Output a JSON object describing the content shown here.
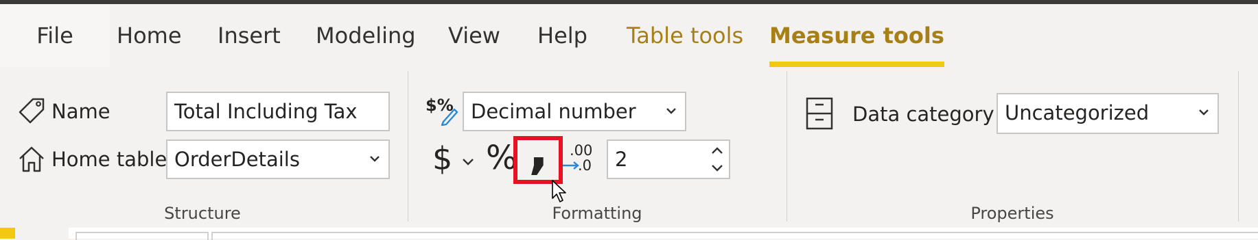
{
  "tabs": [
    {
      "label": "File"
    },
    {
      "label": "Home"
    },
    {
      "label": "Insert"
    },
    {
      "label": "Modeling"
    },
    {
      "label": "View"
    },
    {
      "label": "Help"
    },
    {
      "label": "Table tools"
    },
    {
      "label": "Measure tools"
    }
  ],
  "active_tab": "Measure tools",
  "structure": {
    "group_label": "Structure",
    "name_label": "Name",
    "name_value": "Total Including Tax",
    "home_table_label": "Home table",
    "home_table_value": "OrderDetails"
  },
  "formatting": {
    "group_label": "Formatting",
    "format_value": "Decimal number",
    "currency_symbol": "$",
    "percent_symbol": "%",
    "comma_symbol": ",",
    "decimals_icon_text": ".00",
    "decimals_icon_text2": ".0",
    "decimal_places_value": "2"
  },
  "properties": {
    "group_label": "Properties",
    "data_category_label": "Data category",
    "data_category_value": "Uncategorized"
  },
  "colors": {
    "accent_gold": "#a67f17",
    "underline_yellow": "#f2c811",
    "highlight_red": "#e81123",
    "arrow_blue": "#2b88d8"
  },
  "icons": [
    "tag-icon",
    "home-icon",
    "currency-format-icon",
    "dollar-icon",
    "chevron-down-icon",
    "percent-icon",
    "comma-icon",
    "decimal-arrow-icon",
    "spin-up-icon",
    "spin-down-icon",
    "cabinet-icon",
    "mouse-cursor-icon"
  ]
}
